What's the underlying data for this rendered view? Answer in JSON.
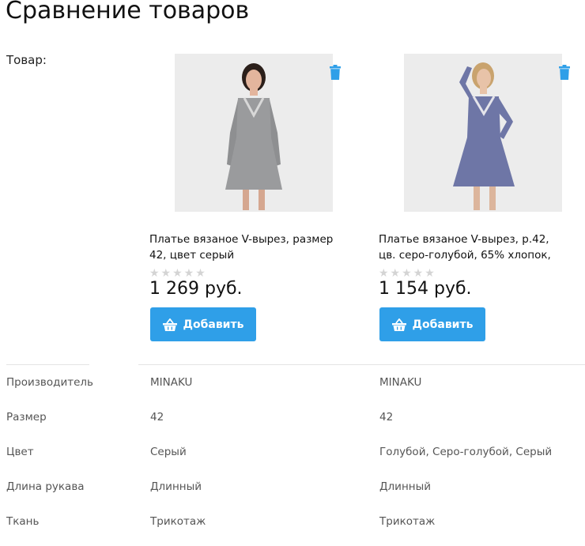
{
  "page": {
    "title": "Сравнение товаров"
  },
  "product_label": "Товар:",
  "products": [
    {
      "name_line1": "Платье вязаное V-вырез, размер",
      "name_line2": "42, цвет серый",
      "rating_stars": "★★★★★",
      "rating": 0,
      "price": "1 269 руб.",
      "add_label": "Добавить",
      "image_icon": "dress-gray-photo",
      "delete_icon": "trash-icon",
      "dress_color": "#9a9b9d"
    },
    {
      "name_line1": "Платье вязаное V-вырез, р.42,",
      "name_line2": "цв. серо-голубой, 65% хлопок,",
      "rating_stars": "★★★★★",
      "rating": 0,
      "price": "1 154 руб.",
      "add_label": "Добавить",
      "image_icon": "dress-blue-gray-photo",
      "delete_icon": "trash-icon",
      "dress_color": "#6e76a6"
    }
  ],
  "specs": [
    {
      "label": "Производитель",
      "values": [
        "MINAKU",
        "MINAKU"
      ]
    },
    {
      "label": "Размер",
      "values": [
        "42",
        "42"
      ]
    },
    {
      "label": "Цвет",
      "values": [
        "Серый",
        "Голубой, Серо-голубой, Серый"
      ]
    },
    {
      "label": "Длина рукава",
      "values": [
        "Длинный",
        "Длинный"
      ]
    },
    {
      "label": "Ткань",
      "values": [
        "Трикотаж",
        "Трикотаж"
      ]
    }
  ],
  "colors": {
    "accent": "#2f9fe8",
    "star_empty": "#d4d4d4",
    "divider": "#e4e4e4"
  }
}
